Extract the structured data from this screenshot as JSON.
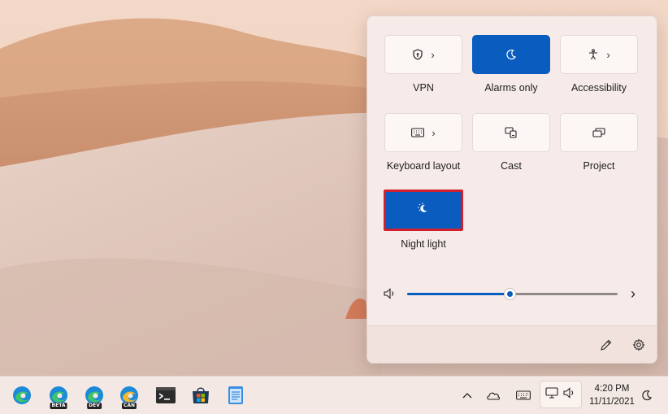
{
  "quick_settings": {
    "tiles": [
      {
        "label": "VPN",
        "icon": "shield-icon",
        "active": false,
        "has_arrow": true
      },
      {
        "label": "Alarms only",
        "icon": "moon-icon",
        "active": true,
        "has_arrow": false
      },
      {
        "label": "Accessibility",
        "icon": "accessibility-icon",
        "active": false,
        "has_arrow": true
      },
      {
        "label": "Keyboard layout",
        "icon": "keyboard-icon",
        "active": false,
        "has_arrow": true
      },
      {
        "label": "Cast",
        "icon": "cast-icon",
        "active": false,
        "has_arrow": false
      },
      {
        "label": "Project",
        "icon": "project-icon",
        "active": false,
        "has_arrow": false
      },
      {
        "label": "Night light",
        "icon": "night-light-icon",
        "active": true,
        "has_arrow": false,
        "highlighted": true
      }
    ],
    "volume": {
      "level_percent": 49,
      "icon": "speaker-icon",
      "more_icon": "chevron-right-icon"
    },
    "footer": {
      "edit_icon": "pencil-icon",
      "settings_icon": "gear-icon"
    }
  },
  "taskbar": {
    "apps": [
      {
        "name": "Microsoft Edge",
        "icon": "edge-icon",
        "badge": ""
      },
      {
        "name": "Microsoft Edge Beta",
        "icon": "edge-beta-icon",
        "badge": "BETA"
      },
      {
        "name": "Microsoft Edge Dev",
        "icon": "edge-dev-icon",
        "badge": "DEV"
      },
      {
        "name": "Microsoft Edge Canary",
        "icon": "edge-canary-icon",
        "badge": "CAN"
      },
      {
        "name": "Terminal",
        "icon": "terminal-icon",
        "badge": ""
      },
      {
        "name": "Microsoft Store",
        "icon": "store-icon",
        "badge": ""
      },
      {
        "name": "Notepad",
        "icon": "notepad-icon",
        "badge": ""
      }
    ],
    "clock": {
      "time": "4:20 PM",
      "date": "11/11/2021"
    }
  },
  "colors": {
    "accent": "#0b5cbf",
    "highlight": "#d0202e",
    "flyout_bg": "#f6ebe8"
  }
}
